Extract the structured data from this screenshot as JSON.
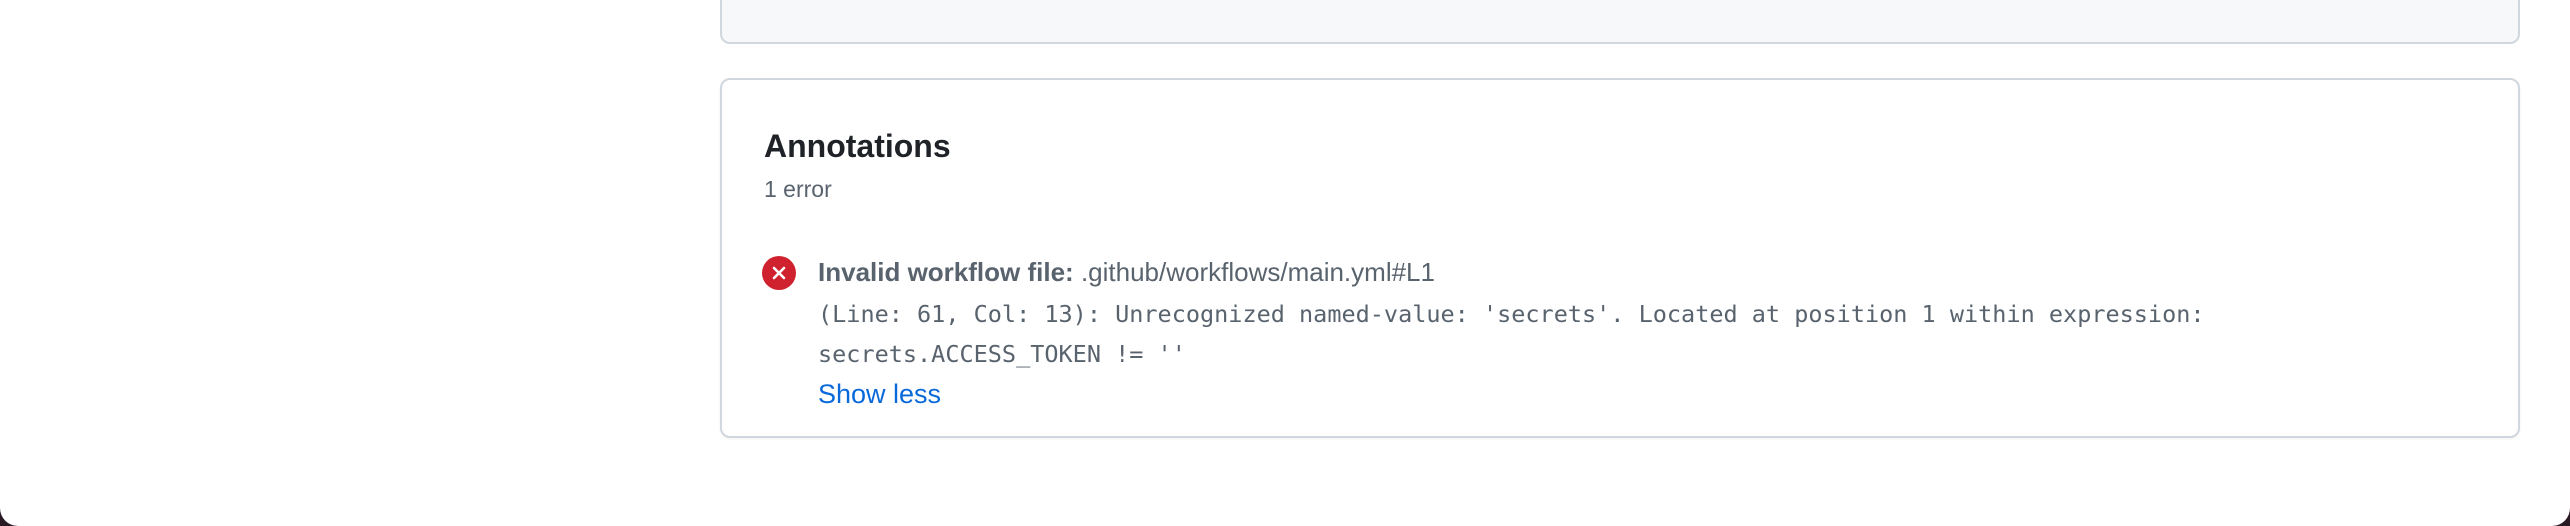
{
  "annotations": {
    "title": "Annotations",
    "count_label": "1 error",
    "items": [
      {
        "severity_icon": "x-circle-fill-icon",
        "heading_label": "Invalid workflow file:",
        "file_path": ".github/workflows/main.yml#L1",
        "message_line1": "(Line: 61, Col: 13): Unrecognized named-value: 'secrets'. Located at position 1 within expression:",
        "message_line2": "secrets.ACCESS_TOKEN != ''",
        "toggle_label": "Show less"
      }
    ]
  },
  "colors": {
    "error": "#cf222e",
    "link": "#0969da",
    "muted_text": "#59636e",
    "border": "#d0d7de"
  }
}
